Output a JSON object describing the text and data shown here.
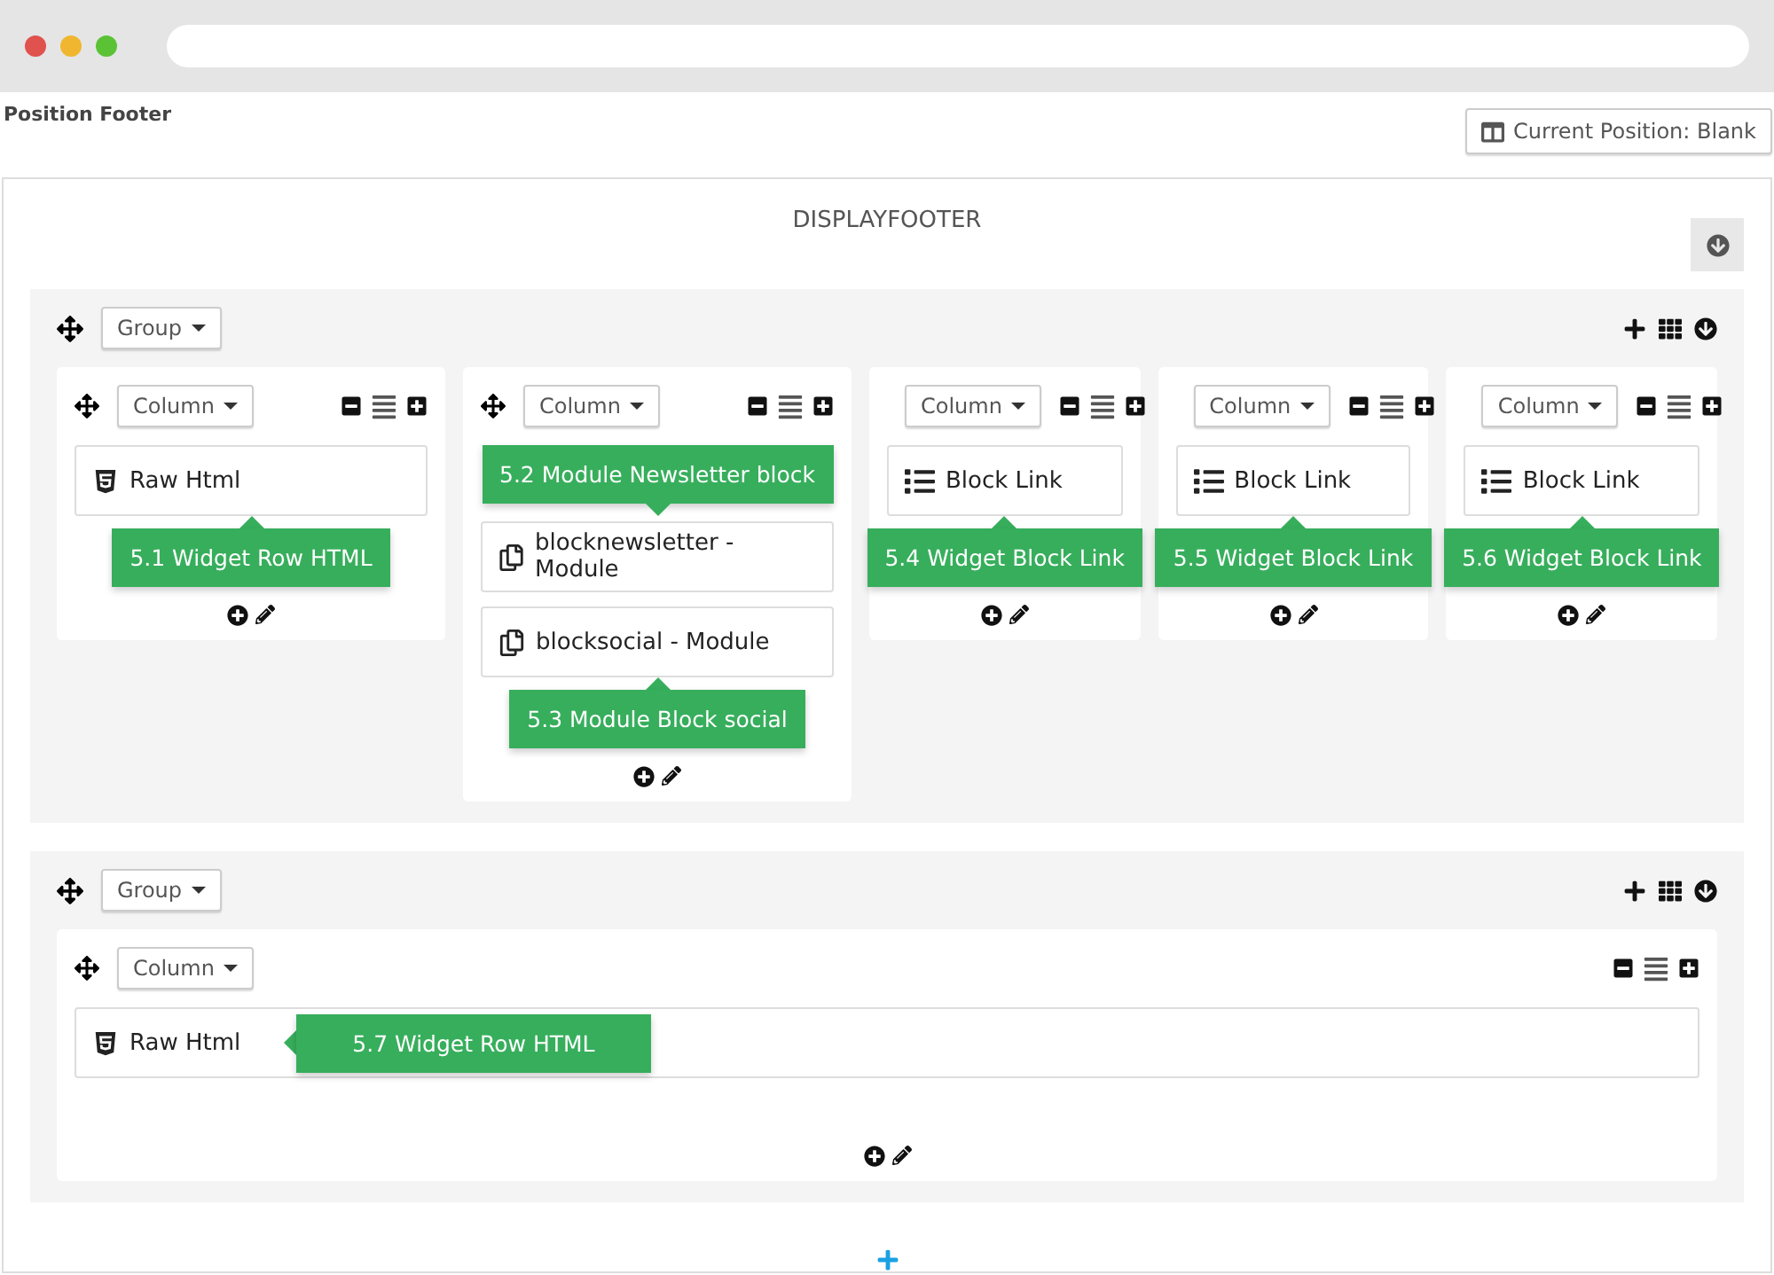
{
  "page_title": "Position Footer",
  "position_button": "Current Position: Blank",
  "hook": "DISPLAYFOOTER",
  "groups": [
    {
      "label": "Group",
      "columns": [
        {
          "label": "Column",
          "widgets": [
            {
              "kind": "html",
              "name": "Raw Html",
              "tooltip": "5.1 Widget Row HTML",
              "tooltip_above": false
            }
          ]
        },
        {
          "label": "Column",
          "widgets": [
            {
              "kind": "module",
              "name": "blocknewsletter - Module",
              "tooltip": "5.2 Module Newsletter block",
              "tooltip_above": true
            },
            {
              "kind": "module",
              "name": "blocksocial - Module",
              "tooltip": "5.3 Module Block social",
              "tooltip_above": false
            }
          ]
        },
        {
          "label": "Column",
          "widgets": [
            {
              "kind": "link",
              "name": "Block Link",
              "tooltip": "5.4 Widget Block Link",
              "tooltip_above": false
            }
          ]
        },
        {
          "label": "Column",
          "widgets": [
            {
              "kind": "link",
              "name": "Block Link",
              "tooltip": "5.5 Widget Block Link",
              "tooltip_above": false
            }
          ]
        },
        {
          "label": "Column",
          "widgets": [
            {
              "kind": "link",
              "name": "Block Link",
              "tooltip": "5.6 Widget Block Link",
              "tooltip_above": false
            }
          ]
        }
      ]
    },
    {
      "label": "Group",
      "columns": [
        {
          "label": "Column",
          "widgets": [
            {
              "kind": "html",
              "name": "Raw Html",
              "tooltip": "5.7 Widget Row HTML"
            }
          ]
        }
      ]
    }
  ]
}
